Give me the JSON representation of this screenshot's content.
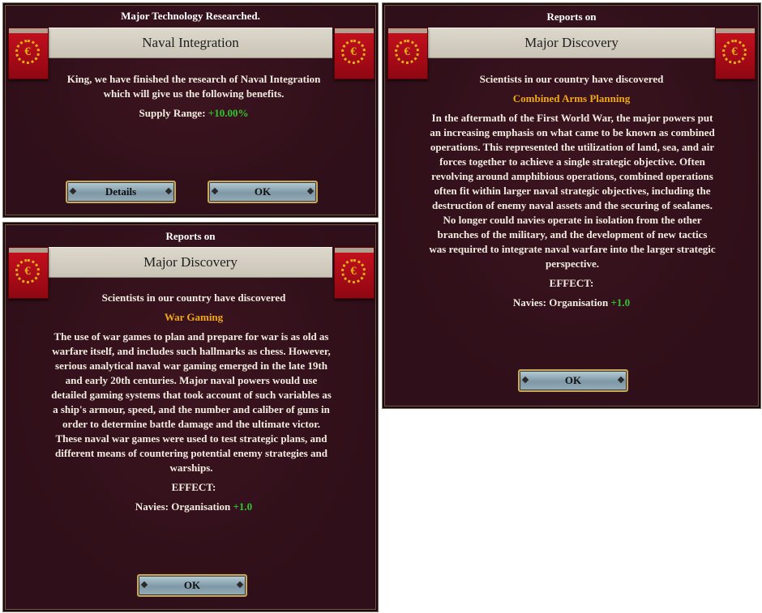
{
  "tech": {
    "heading": "Major Technology Researched.",
    "title": "Naval Integration",
    "body": "King, we have finished the research of Naval Integration which will give us the following benefits.",
    "benefit_label": "Supply Range: ",
    "benefit_value": "+10.00%",
    "details_label": "Details",
    "ok_label": "OK"
  },
  "war_gaming": {
    "heading": "Reports on",
    "title": "Major Discovery",
    "intro": "Scientists in our country have discovered",
    "name": "War Gaming",
    "body": "The use of war games to plan and prepare for war is as old as warfare itself, and includes such hallmarks as chess. However, serious analytical naval war gaming emerged in the late 19th and early 20th centuries. Major naval powers would use detailed gaming systems that took account of such variables as a ship's armour, speed, and the number and caliber of guns in order to determine battle damage and the ultimate victor. These naval war games were used to test strategic plans, and different means of countering potential enemy strategies and warships.",
    "effect_label": "EFFECT:",
    "effect_name": "Navies: Organisation ",
    "effect_value": "+1.0",
    "ok_label": "OK"
  },
  "combined_arms": {
    "heading": "Reports on",
    "title": "Major Discovery",
    "intro": "Scientists in our country have discovered",
    "name": "Combined Arms Planning",
    "body": "In the aftermath of the First World War, the major powers put an increasing emphasis on what came to be known as combined operations. This represented the utilization of land, sea, and air forces together to achieve a single strategic objective. Often revolving around amphibious operations, combined operations often fit within larger naval strategic objectives, including the destruction of enemy naval assets and the securing of sealanes. No longer could navies operate in isolation from the other branches of the military, and the development of new tactics was required to integrate naval warfare into the larger strategic perspective.",
    "effect_label": "EFFECT:",
    "effect_name": "Navies: Organisation ",
    "effect_value": "+1.0",
    "ok_label": "OK"
  },
  "icons": {
    "banner": "red-banner-emblem-icon",
    "emblem_glyph": "€"
  },
  "colors": {
    "panel_bg": "#2f0f19",
    "tech_name": "#f0a818",
    "positive_value": "#2ec52e"
  }
}
